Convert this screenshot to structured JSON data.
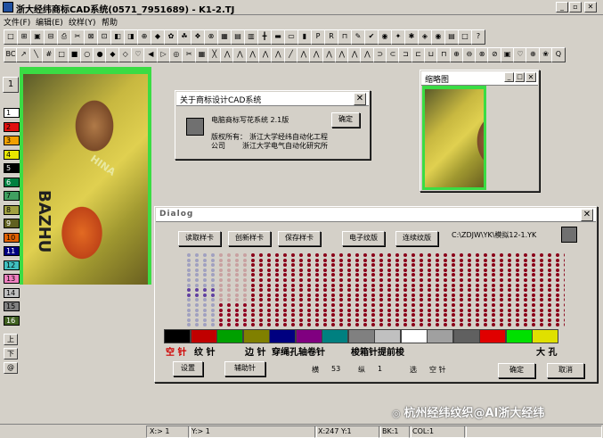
{
  "window": {
    "title": "浙大经纬商标CAD系统(0571_7951689) - K1-2.TJ"
  },
  "menu": [
    "文件(F)",
    "编辑(E)",
    "纹样(Y)",
    "帮助"
  ],
  "toolbar1": [
    "□",
    "⊞",
    "▣",
    "⊟",
    "⎙",
    "✂",
    "⊠",
    "⊡",
    "◧",
    "◨",
    "⊕",
    "◆",
    "✿",
    "☘",
    "❖",
    "⊗",
    "▦",
    "▤",
    "▥",
    "╋",
    "▬",
    "▭",
    "▮",
    "P",
    "R",
    "⊓",
    "✎",
    "✔",
    "◉",
    "✦",
    "✱",
    "◈",
    "◉",
    "▤",
    "□",
    "?"
  ],
  "toolbar2": [
    "BC",
    "↗",
    "╲",
    "#",
    "□",
    "■",
    "○",
    "●",
    "◆",
    "◇",
    "♡",
    "◀",
    "▷",
    "◎",
    "✂",
    "▦",
    "╳",
    "⋀",
    "⋀",
    "⋀",
    "⋀",
    "⋀",
    "╱",
    "⋀",
    "⋀",
    "⋀",
    "⋀",
    "⋀",
    "⋀",
    "⊃",
    "⊂",
    "⊐",
    "⊏",
    "⊔",
    "⊓",
    "⊕",
    "⊖",
    "⊗",
    "⊘",
    "▣",
    "♡",
    "⊕",
    "❀",
    "Q"
  ],
  "palette": [
    "1",
    "2",
    "3",
    "4",
    "5",
    "6",
    "7",
    "8",
    "9",
    "10",
    "11",
    "12",
    "13",
    "14",
    "15",
    "16"
  ],
  "palette_colors": [
    "#ffffff",
    "#e01010",
    "#f0a000",
    "#e8e800",
    "#000000",
    "#008040",
    "#40a060",
    "#a0a040",
    "#606020",
    "#e06000",
    "#000080",
    "#40c0c0",
    "#f080c0",
    "#c0c0c0",
    "#808080",
    "#406020"
  ],
  "canvas_text": [
    "HINA",
    "BAZHU",
    "BAZHU"
  ],
  "about": {
    "title": "关于商标设计CAD系统",
    "product": "电脑商标写花系统 2.1版",
    "copyright_label": "版权所有：",
    "copyright_value": "浙江大学经纬自动化工程",
    "company_label": "公司",
    "company_value": "浙江大学电气自动化研究所",
    "ok": "确定"
  },
  "thumb": {
    "title": "缩略图",
    "text": "BAZHU"
  },
  "dialog": {
    "title": "Dialog",
    "buttons": [
      "读取样卡",
      "创新样卡",
      "保存样卡",
      "电子纹版",
      "连续纹版"
    ],
    "path": "C:\\ZDJW\\YK\\模拟12-1.YK",
    "colors": [
      "#000000",
      "#c00000",
      "#00a000",
      "#808000",
      "#000080",
      "#800080",
      "#008080",
      "#808080",
      "#c0c0c0",
      "#ffffff",
      "#a0a0a0",
      "#606060",
      "#e00000",
      "#00e000",
      "#e0e000"
    ],
    "labels": {
      "kongzhen": "空 针",
      "wenzhen": "纹 针",
      "bianzhen": "边 针",
      "chuanjing": "穿绳孔",
      "zhongjuan": "轴卷针",
      "suozhen": "梭箱针",
      "tiqian": "提前梭",
      "dakong": "大 孔"
    },
    "settings": "设置",
    "aux": "辅助针",
    "heng_label": "横",
    "heng_value": "53",
    "zong_label": "纵",
    "zong_value": "1",
    "xuan_label": "选",
    "xuan_value": "空 针",
    "ok": "确定",
    "cancel": "取消"
  },
  "watermark": "杭州经纬纹织@AI浙大经纬",
  "status": {
    "x": "X:> 1",
    "y": "Y:> 1",
    "coord": "X:247  Y:1",
    "bk": "BK:1",
    "col": "COL:1"
  }
}
